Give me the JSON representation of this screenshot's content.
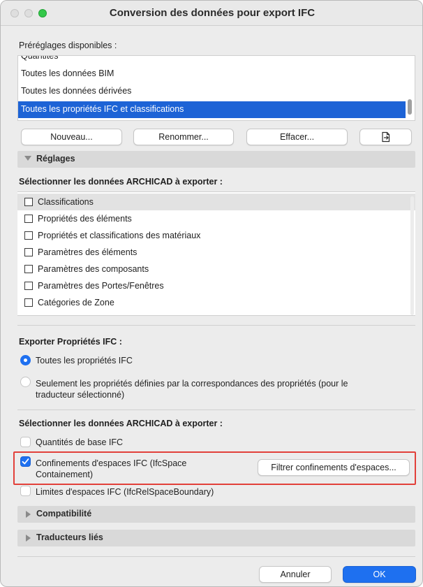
{
  "window": {
    "title": "Conversion des données pour export IFC"
  },
  "presets": {
    "label": "Préréglages disponibles :",
    "items": [
      "Quantités",
      "Toutes les données BIM",
      "Toutes les données dérivées",
      "Toutes les propriétés IFC et classifications"
    ],
    "selected_index": 3
  },
  "preset_buttons": {
    "new": "Nouveau...",
    "rename": "Renommer...",
    "delete": "Effacer...",
    "export_icon": "export-file-icon"
  },
  "settings_section": {
    "label": "Réglages",
    "expanded": true
  },
  "archicad_data": {
    "label": "Sélectionner les données ARCHICAD à exporter :",
    "items": [
      "Classifications",
      "Propriétés des éléments",
      "Propriétés et classifications des matériaux",
      "Paramètres des éléments",
      "Paramètres des composants",
      "Paramètres des Portes/Fenêtres",
      "Catégories de Zone"
    ],
    "highlighted_index": 0
  },
  "ifc_properties": {
    "label": "Exporter Propriétés IFC :",
    "option_all": "Toutes les propriétés IFC",
    "option_mapped_line1": "Seulement les propriétés définies par la correspondances des propriétés (pour le",
    "option_mapped_line2": "traducteur sélectionné)",
    "selected": "option_all"
  },
  "archicad_export": {
    "label": "Sélectionner les données ARCHICAD à exporter :",
    "base_quantities": "Quantités de base IFC",
    "base_quantities_checked": false,
    "containment_line1": "Confinements d'espaces IFC (IfcSpace",
    "containment_line2": "Containement)",
    "containment_checked": true,
    "filter_button": "Filtrer confinements d'espaces...",
    "boundaries": "Limites d'espaces IFC (IfcRelSpaceBoundary)",
    "boundaries_checked": false
  },
  "compat_section": {
    "label": "Compatibilité",
    "expanded": false
  },
  "translators_section": {
    "label": "Traducteurs liés",
    "expanded": false
  },
  "footer": {
    "cancel": "Annuler",
    "ok": "OK"
  },
  "colors": {
    "accent": "#1e70f0",
    "selection": "#1d63d6",
    "highlight_border": "#e2403a"
  }
}
